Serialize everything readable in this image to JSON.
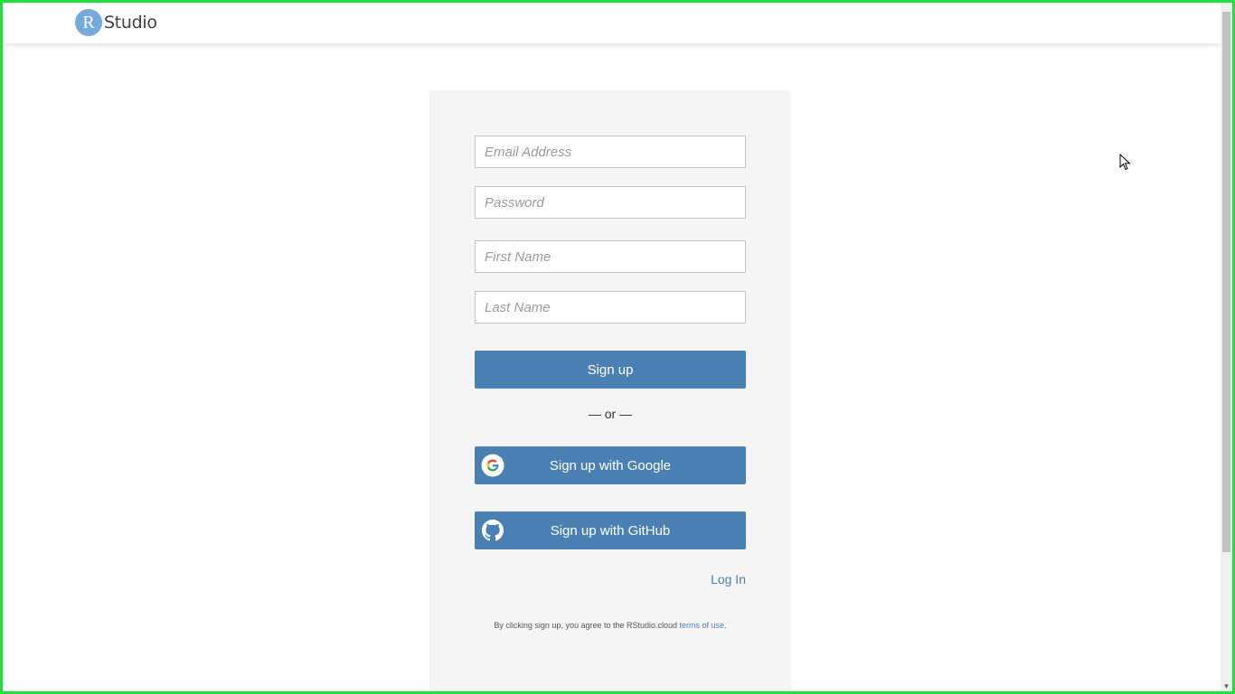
{
  "header": {
    "logo_letter": "R",
    "logo_text": "Studio"
  },
  "form": {
    "email_placeholder": "Email Address",
    "password_placeholder": "Password",
    "first_name_placeholder": "First Name",
    "last_name_placeholder": "Last Name",
    "signup_label": "Sign up",
    "or_text": "— or —",
    "google_label": "Sign up with Google",
    "github_label": "Sign up with GitHub",
    "login_label": "Log In",
    "terms_prefix": "By clicking sign up, you agree to the RStudio.cloud ",
    "terms_link": "terms of use",
    "terms_suffix": "."
  },
  "colors": {
    "accent": "#4a80b4",
    "logo_circle": "#75aadb",
    "panel_bg": "#f5f5f6",
    "frame": "#22e03a"
  },
  "icons": {
    "google": "google-icon",
    "github": "github-icon"
  }
}
